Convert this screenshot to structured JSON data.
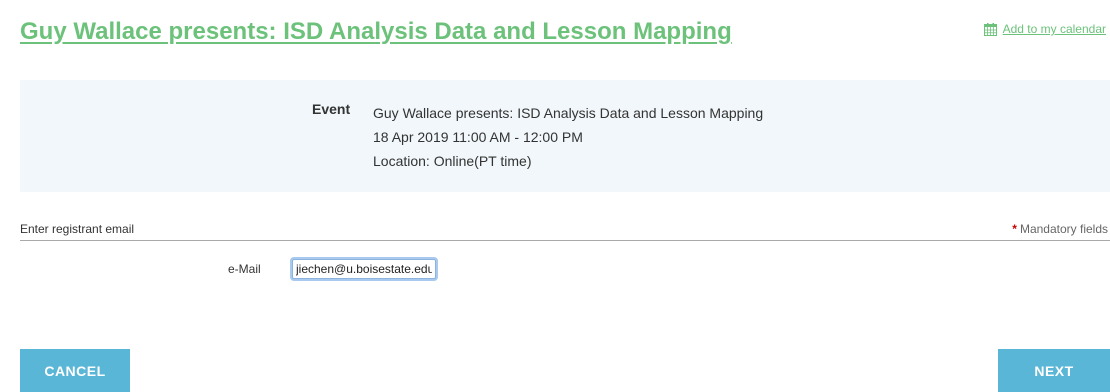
{
  "header": {
    "title": "Guy Wallace presents: ISD Analysis Data and Lesson Mapping",
    "calendar_link": "Add to my calendar",
    "calendar_icon": "calendar-icon"
  },
  "event": {
    "label": "Event",
    "name": "Guy Wallace presents: ISD Analysis Data and Lesson Mapping",
    "datetime": "18 Apr 2019 11:00 AM - 12:00 PM",
    "location": "Location: Online(PT time)"
  },
  "form": {
    "section_title": "Enter registrant email",
    "mandatory_marker": "*",
    "mandatory_text": "Mandatory fields",
    "email_label": "e-Mail",
    "email_value": "jiechen@u.boisestate.edu"
  },
  "actions": {
    "cancel_label": "CANCEL",
    "next_label": "NEXT"
  },
  "colors": {
    "link_green": "#6cc27a",
    "button_blue": "#5ab6d6",
    "info_bg": "#f1f7fa",
    "mandatory_red": "#cc0000"
  }
}
